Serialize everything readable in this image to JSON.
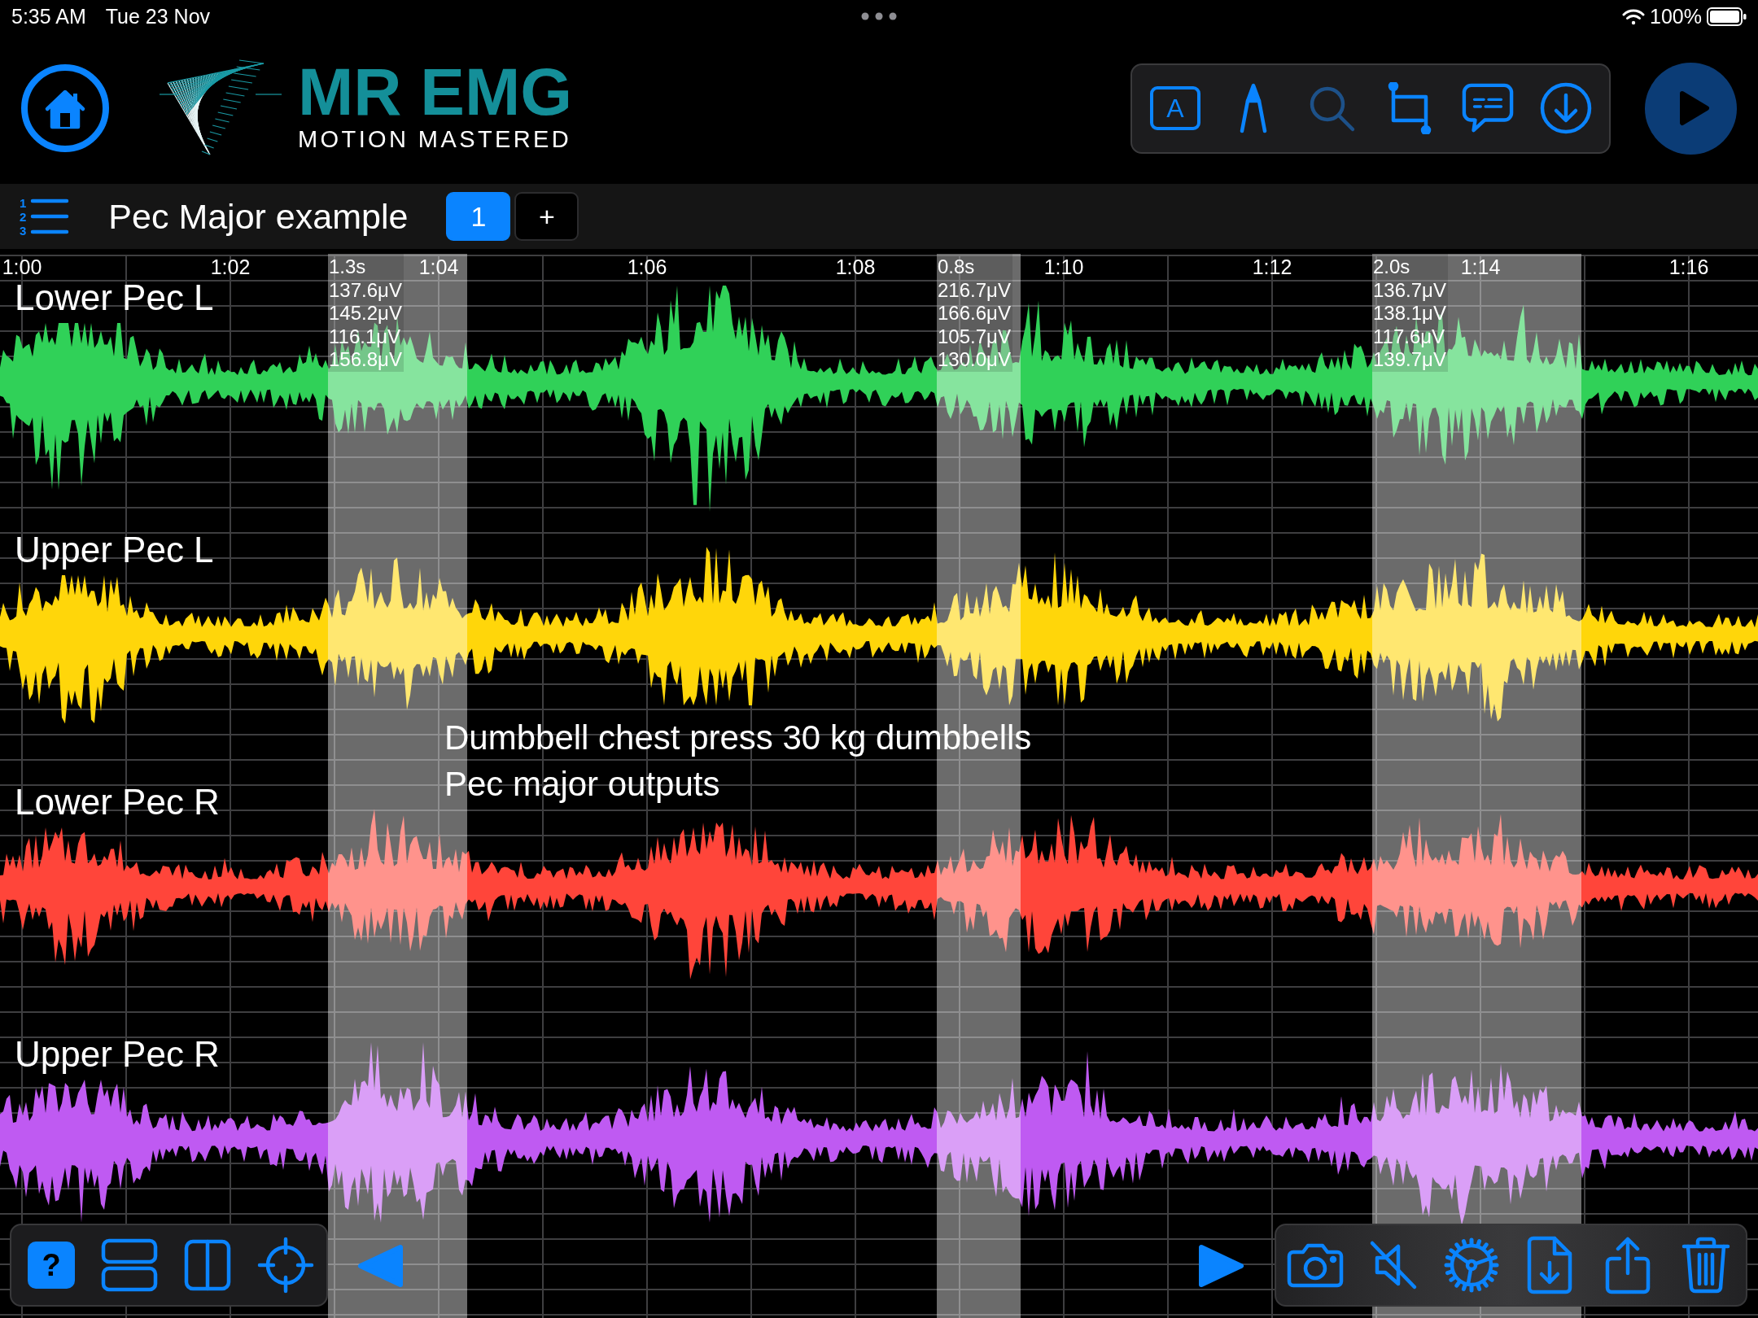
{
  "status_bar": {
    "time": "5:35 AM",
    "date": "Tue 23 Nov",
    "battery": "100%"
  },
  "header": {
    "logo": {
      "title": "MR EMG",
      "tagline": "MOTION MASTERED"
    },
    "tools": {
      "text_tool": {
        "label": "A"
      },
      "search_tool": {
        "disabled": true
      }
    }
  },
  "session": {
    "list_numbers": [
      "1",
      "2",
      "3"
    ],
    "title": "Pec Major example",
    "pages": [
      {
        "label": "1",
        "selected": true
      }
    ],
    "add_label": "+"
  },
  "chart": {
    "time_labels": [
      "1:00",
      "1:02",
      "1:04",
      "1:06",
      "1:08",
      "1:10",
      "1:12",
      "1:14",
      "1:16"
    ],
    "channels": [
      {
        "name": "Lower Pec L",
        "color": "#30d158"
      },
      {
        "name": "Upper Pec L",
        "color": "#ffd60a"
      },
      {
        "name": "Lower Pec R",
        "color": "#ff453a"
      },
      {
        "name": "Upper Pec R",
        "color": "#bf5af2"
      }
    ],
    "selections": [
      {
        "duration": "1.3s",
        "values": [
          "137.6μV",
          "145.2μV",
          "116.1μV",
          "156.8μV"
        ]
      },
      {
        "duration": "0.8s",
        "values": [
          "216.7μV",
          "166.6μV",
          "105.7μV",
          "130.0μV"
        ]
      },
      {
        "duration": "2.0s",
        "values": [
          "136.7μV",
          "138.1μV",
          "117.6μV",
          "139.7μV"
        ]
      }
    ],
    "annotation": [
      "Dumbbell chest press 30 kg dumbbells",
      "Pec major outputs"
    ]
  },
  "bottom_bar": {
    "help_label": "?"
  }
}
